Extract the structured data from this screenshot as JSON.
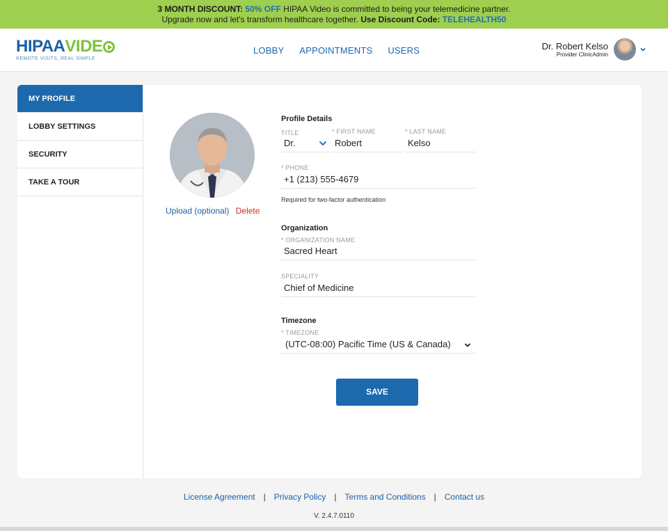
{
  "promo": {
    "lead": "3 MONTH DISCOUNT:",
    "offer": "50% OFF",
    "text1": "HIPAA Video is committed to being your telemedicine partner.",
    "text2": "Upgrade now and let's transform healthcare together.",
    "code_label": "Use Discount Code:",
    "code": "TELEHEALTH50"
  },
  "brand": {
    "hipaa": "HIPAA",
    "video": "VIDE",
    "tagline": "REMOTE VISITS, REAL SIMPLE"
  },
  "nav": {
    "lobby": "LOBBY",
    "appointments": "APPOINTMENTS",
    "users": "USERS"
  },
  "user": {
    "name": "Dr. Robert Kelso",
    "role": "Provider ClinicAdmin"
  },
  "sidebar": {
    "items": [
      {
        "label": "MY PROFILE"
      },
      {
        "label": "LOBBY SETTINGS"
      },
      {
        "label": "SECURITY"
      },
      {
        "label": "TAKE A TOUR"
      }
    ]
  },
  "avatar": {
    "upload": "Upload (optional)",
    "delete": "Delete"
  },
  "profile": {
    "section": "Profile Details",
    "title_label": "TITLE",
    "title_value": "Dr.",
    "first_label": "* FIRST NAME",
    "first_value": "Robert",
    "last_label": "* LAST NAME",
    "last_value": "Kelso",
    "phone_label": "* PHONE",
    "phone_value": "+1 (213) 555-4679",
    "phone_hint": "Required for two-factor authentication"
  },
  "organization": {
    "section": "Organization",
    "name_label": "* ORGANIZATION NAME",
    "name_value": "Sacred Heart",
    "speciality_label": "SPECIALITY",
    "speciality_value": "Chief of Medicine"
  },
  "timezone": {
    "section": "Timezone",
    "label": "* TIMEZONE",
    "value": "(UTC-08:00) Pacific Time (US & Canada)"
  },
  "save_label": "SAVE",
  "footer": {
    "license": "License Agreement",
    "privacy": "Privacy Policy",
    "terms": "Terms and Conditions",
    "contact": "Contact us",
    "version": "V. 2.4.7.0110"
  },
  "colors": {
    "promo_bg": "#9fcf4e",
    "primary": "#1d69ae",
    "brand_green": "#7dc23b",
    "delete": "#e02020"
  }
}
